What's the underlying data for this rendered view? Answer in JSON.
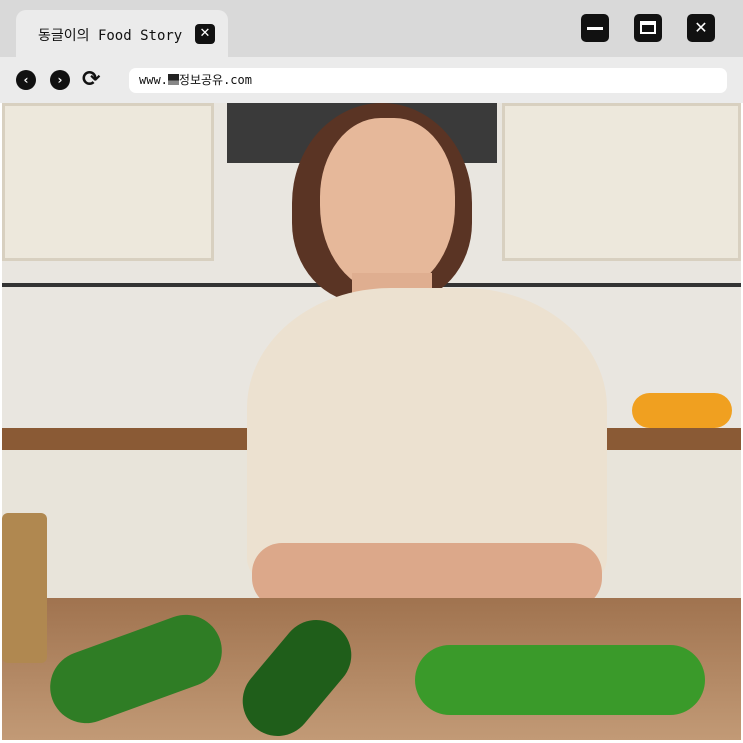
{
  "tab": {
    "title": "동글이의 Food Story",
    "close_label": "✕"
  },
  "window": {
    "minimize": "minimize",
    "maximize": "maximize",
    "close_label": "✕"
  },
  "nav": {
    "back": "‹",
    "forward": "›",
    "reload": "⟳",
    "url_prefix": "www.",
    "url_domain": "정보공유.com"
  },
  "photo": {
    "description_alt": "Woman in kitchen looking at cucumbers on wooden table"
  }
}
